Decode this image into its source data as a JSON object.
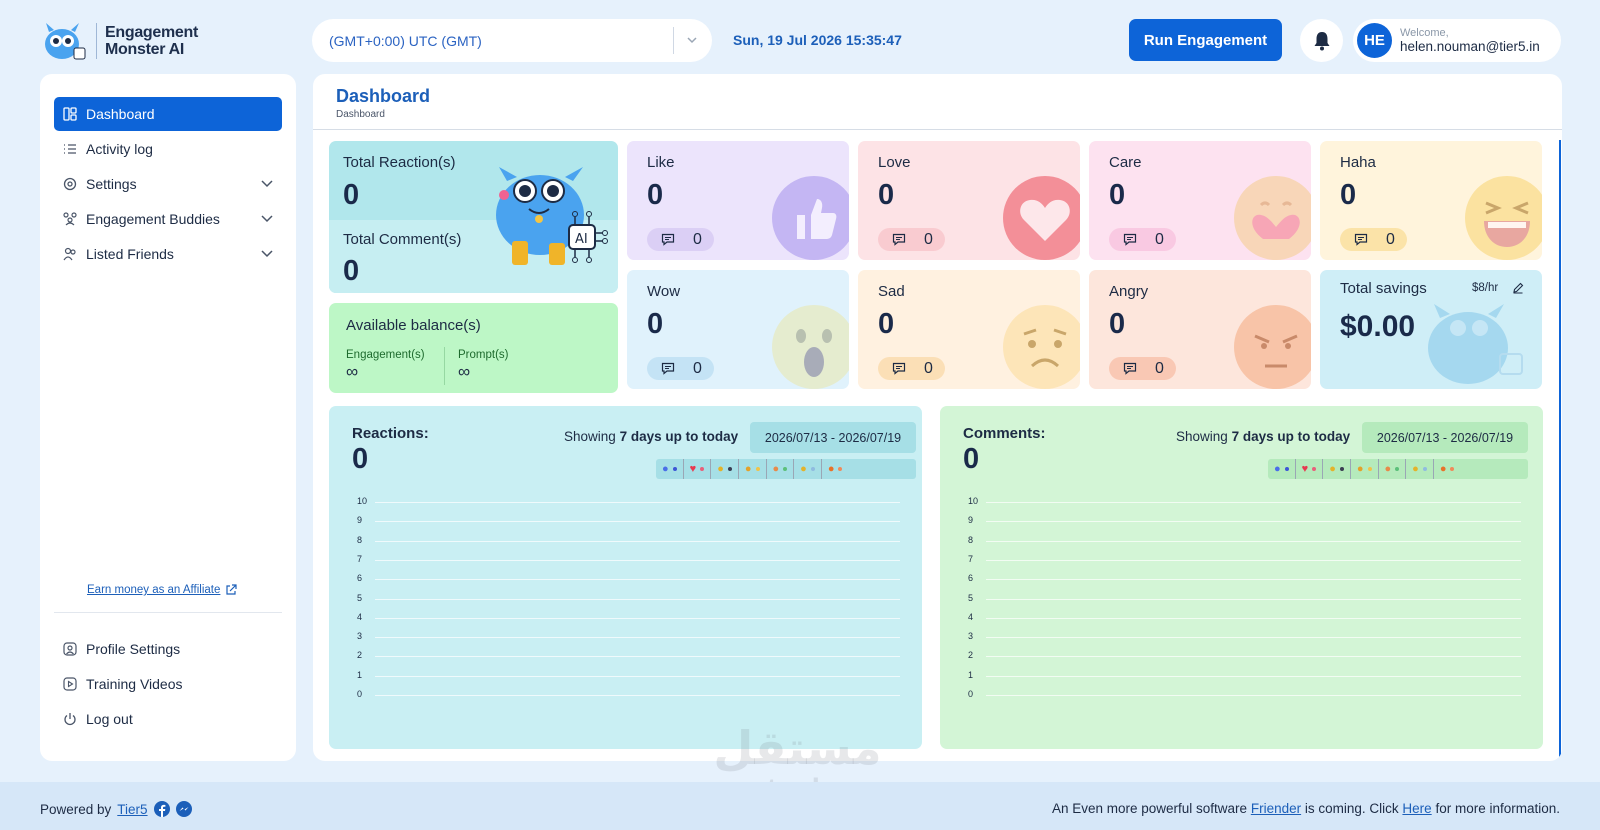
{
  "brand": {
    "line1": "Engagement",
    "line2": "Monster AI"
  },
  "header": {
    "timezone": "(GMT+0:00) UTC (GMT)",
    "datetime": "Sun, 19 Jul 2026 15:35:47",
    "run_button": "Run Engagement",
    "user_initials": "HE",
    "welcome": "Welcome,",
    "email": "helen.nouman@tier5.in"
  },
  "sidebar": {
    "items": [
      {
        "label": "Dashboard"
      },
      {
        "label": "Activity log"
      },
      {
        "label": "Settings"
      },
      {
        "label": "Engagement Buddies"
      },
      {
        "label": "Listed Friends"
      }
    ],
    "affiliate": "Earn money as an Affiliate",
    "bottom": [
      {
        "label": "Profile Settings"
      },
      {
        "label": "Training Videos"
      },
      {
        "label": "Log out"
      }
    ]
  },
  "page": {
    "title": "Dashboard",
    "breadcrumb": "Dashboard"
  },
  "summary": {
    "total_reactions_label": "Total Reaction(s)",
    "total_reactions": "0",
    "total_comments_label": "Total Comment(s)",
    "total_comments": "0"
  },
  "balance": {
    "title": "Available balance(s)",
    "engagements_label": "Engagement(s)",
    "engagements_value": "∞",
    "prompts_label": "Prompt(s)",
    "prompts_value": "∞"
  },
  "reactions": [
    {
      "label": "Like",
      "value": "0",
      "comments": "0",
      "color": "#ece4fc"
    },
    {
      "label": "Love",
      "value": "0",
      "comments": "0",
      "color": "#fde3e6"
    },
    {
      "label": "Care",
      "value": "0",
      "comments": "0",
      "color": "#fde2f0"
    },
    {
      "label": "Haha",
      "value": "0",
      "comments": "0",
      "color": "#fff4dc"
    },
    {
      "label": "Wow",
      "value": "0",
      "comments": "0",
      "color": "#e0f2fc"
    },
    {
      "label": "Sad",
      "value": "0",
      "comments": "0",
      "color": "#fff1e0"
    },
    {
      "label": "Angry",
      "value": "0",
      "comments": "0",
      "color": "#fde6dc"
    }
  ],
  "savings": {
    "label": "Total savings",
    "rate": "$8/hr",
    "value": "$0.00"
  },
  "charts": {
    "reactions": {
      "title": "Reactions:",
      "total": "0",
      "showing_prefix": "Showing",
      "showing_bold": "7 days up to today",
      "range": "2026/07/13 - 2026/07/19"
    },
    "comments": {
      "title": "Comments:",
      "total": "0",
      "showing_prefix": "Showing",
      "showing_bold": "7 days up to today",
      "range": "2026/07/13 - 2026/07/19"
    }
  },
  "chart_data": [
    {
      "type": "line",
      "title": "Reactions:",
      "ylim": [
        0,
        10
      ],
      "yticks": [
        "10",
        "9",
        "8",
        "7",
        "6",
        "5",
        "4",
        "3",
        "2",
        "1",
        "0"
      ],
      "series": []
    },
    {
      "type": "line",
      "title": "Comments:",
      "ylim": [
        0,
        10
      ],
      "yticks": [
        "10",
        "9",
        "8",
        "7",
        "6",
        "5",
        "4",
        "3",
        "2",
        "1",
        "0"
      ],
      "series": []
    }
  ],
  "footer": {
    "powered_by": "Powered by",
    "tier5": "Tier5",
    "notice_pre": "An Even more powerful software",
    "friender": "Friender",
    "notice_mid": "is coming. Click",
    "here": "Here",
    "notice_post": "for more information."
  },
  "watermark": {
    "arabic": "مستقل",
    "latin": "mostaql.com"
  }
}
